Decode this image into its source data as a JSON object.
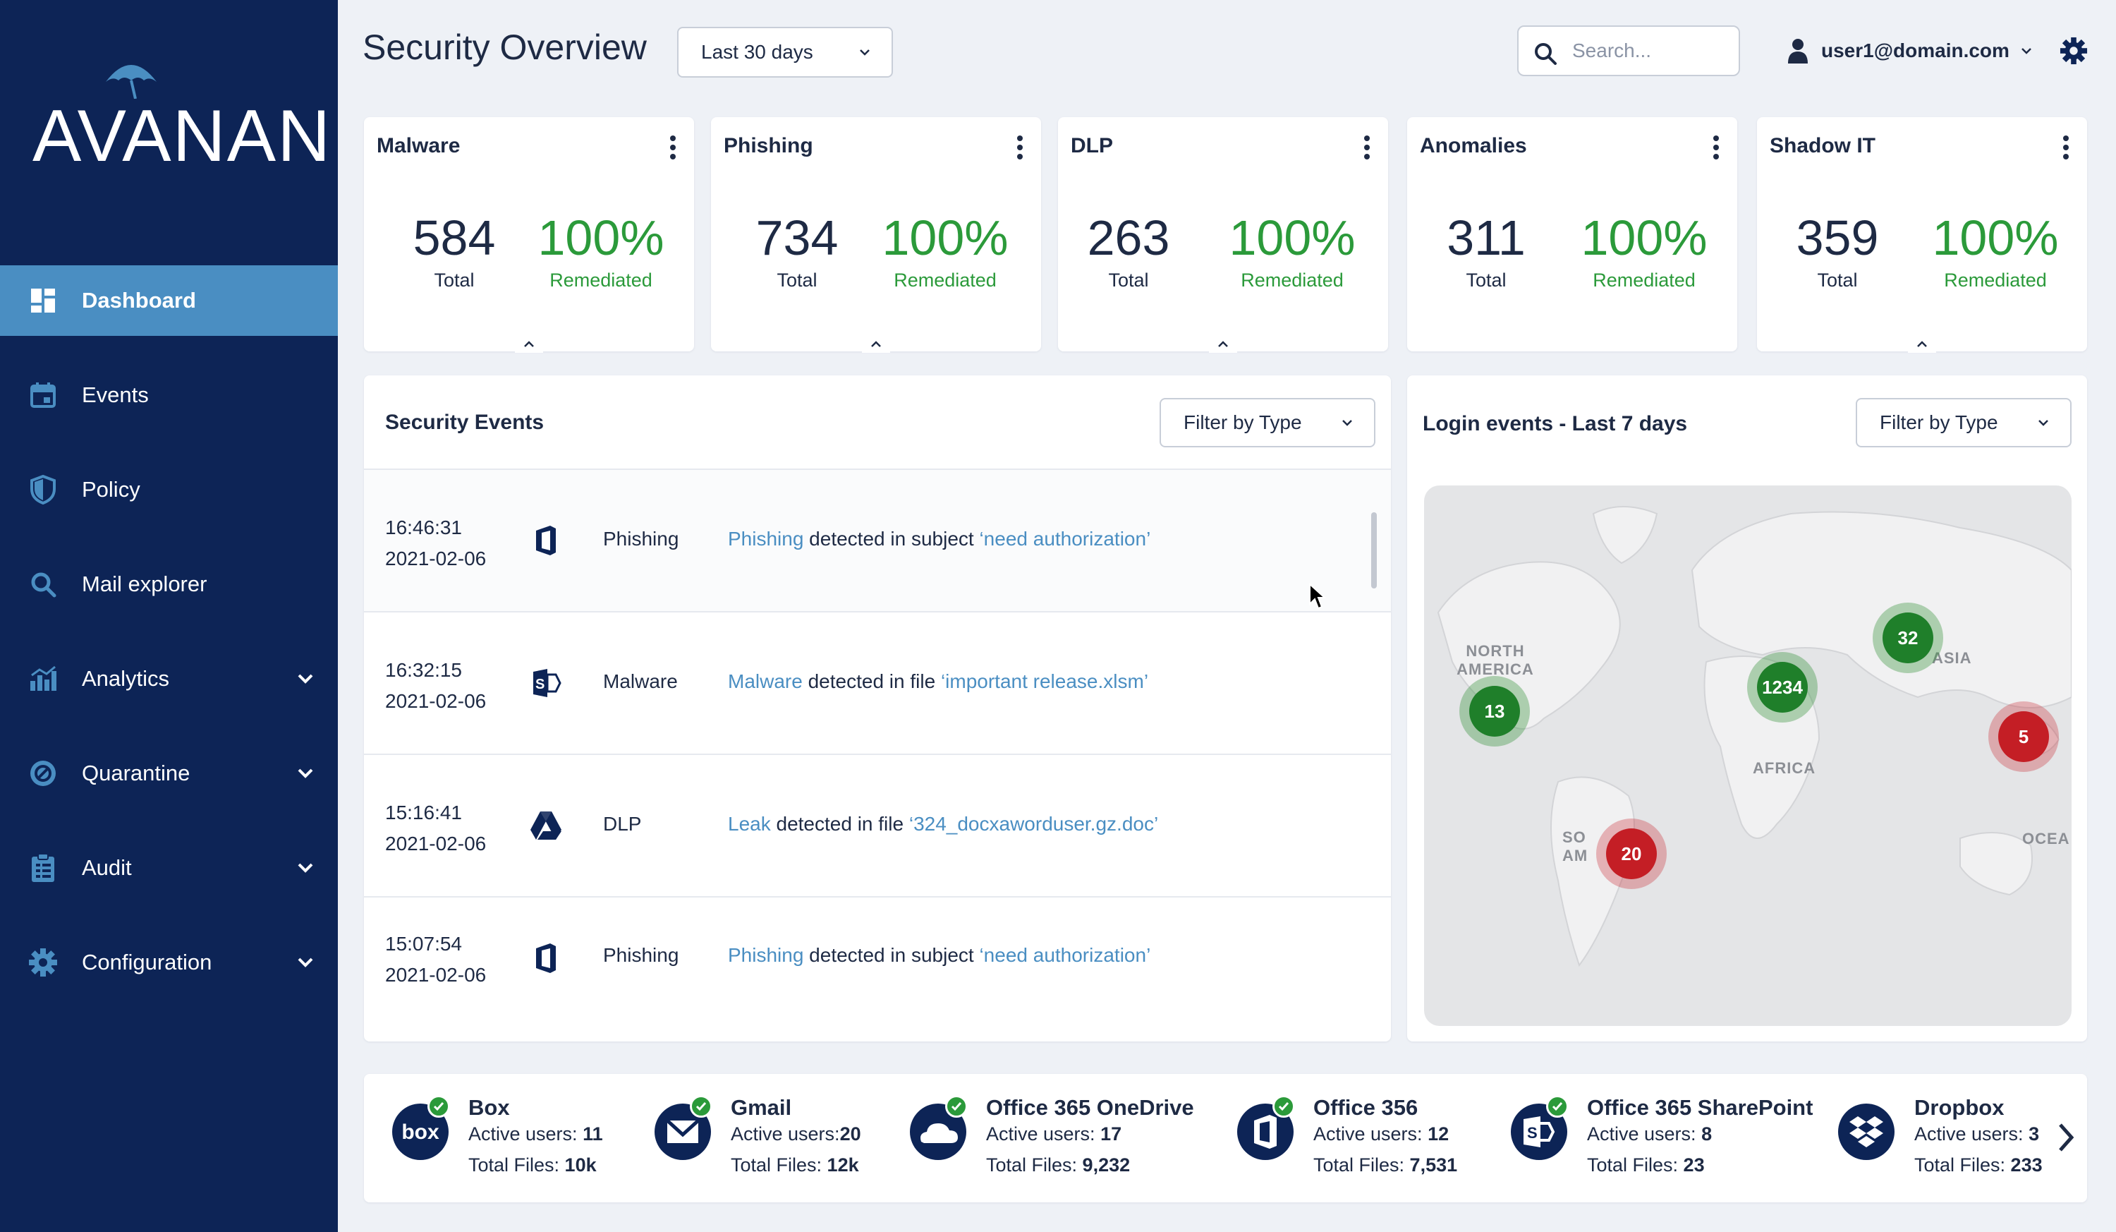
{
  "brand": {
    "logo_text": "AVANAN"
  },
  "nav": {
    "items": [
      {
        "label": "Dashboard",
        "icon": "dashboard-icon",
        "active": true
      },
      {
        "label": "Events",
        "icon": "calendar-icon"
      },
      {
        "label": "Policy",
        "icon": "shield-icon"
      },
      {
        "label": "Mail explorer",
        "icon": "search-icon"
      },
      {
        "label": "Analytics",
        "icon": "bar-chart-icon",
        "expandable": true
      },
      {
        "label": "Quarantine",
        "icon": "quarantine-icon",
        "expandable": true
      },
      {
        "label": "Audit",
        "icon": "clipboard-icon",
        "expandable": true
      },
      {
        "label": "Configuration",
        "icon": "gear-icon",
        "expandable": true
      }
    ]
  },
  "header": {
    "title": "Security Overview",
    "date_range": "Last 30 days",
    "search_placeholder": "Search...",
    "user": "user1@domain.com"
  },
  "stats": [
    {
      "title": "Malware",
      "total": "584",
      "total_label": "Total",
      "remediated": "100%",
      "remediated_label": "Remediated"
    },
    {
      "title": "Phishing",
      "total": "734",
      "total_label": "Total",
      "remediated": "100%",
      "remediated_label": "Remediated"
    },
    {
      "title": "DLP",
      "total": "263",
      "total_label": "Total",
      "remediated": "100%",
      "remediated_label": "Remediated"
    },
    {
      "title": "Anomalies",
      "total": "311",
      "total_label": "Total",
      "remediated": "100%",
      "remediated_label": "Remediated"
    },
    {
      "title": "Shadow IT",
      "total": "359",
      "total_label": "Total",
      "remediated": "100%",
      "remediated_label": "Remediated"
    }
  ],
  "security_events": {
    "title": "Security Events",
    "filter": "Filter by Type",
    "rows": [
      {
        "time": "16:46:31",
        "date": "2021-02-06",
        "icon": "office-icon",
        "type": "Phishing",
        "link": "Phishing",
        "middle": " detected in subject ",
        "target": "‘need authorization’"
      },
      {
        "time": "16:32:15",
        "date": "2021-02-06",
        "icon": "sharepoint-icon",
        "type": "Malware",
        "link": "Malware",
        "middle": " detected in file ",
        "target": "‘important release.xlsm’"
      },
      {
        "time": "15:16:41",
        "date": "2021-02-06",
        "icon": "google-drive-icon",
        "type": "DLP",
        "link": "Leak",
        "middle": " detected in file ",
        "target": "‘324_docxaworduser.gz.doc’"
      },
      {
        "time": "15:07:54",
        "date": "2021-02-06",
        "icon": "office-icon",
        "type": "Phishing",
        "link": "Phishing",
        "middle": " detected in subject ",
        "target": "‘need authorization’"
      }
    ]
  },
  "login_map": {
    "title": "Login events - Last 7 days",
    "filter": "Filter by Type",
    "labels": [
      "NORTH AMERICA",
      "ASIA",
      "AFRICA",
      "SO AM",
      "OCEA"
    ],
    "clusters": [
      {
        "value": "13",
        "status": "green"
      },
      {
        "value": "1234",
        "status": "green"
      },
      {
        "value": "32",
        "status": "green"
      },
      {
        "value": "5",
        "status": "red"
      },
      {
        "value": "20",
        "status": "red"
      }
    ]
  },
  "apps": [
    {
      "name": "Box",
      "users_label": "Active users: ",
      "users": "11",
      "files_label": "Total Files: ",
      "files": "10k",
      "icon": "box-icon"
    },
    {
      "name": "Gmail",
      "users_label": "Active users:",
      "users": "20",
      "files_label": "Total Files: ",
      "files": "12k",
      "icon": "gmail-icon"
    },
    {
      "name": "Office 365 OneDrive",
      "users_label": "Active users: ",
      "users": "17",
      "files_label": "Total Files: ",
      "files": "9,232",
      "icon": "onedrive-icon"
    },
    {
      "name": "Office 356",
      "users_label": "Active users: ",
      "users": "12",
      "files_label": "Total Files: ",
      "files": "7,531",
      "icon": "office-icon"
    },
    {
      "name": "Office 365 SharePoint",
      "users_label": "Active users: ",
      "users": "8",
      "files_label": "Total Files: ",
      "files": "23",
      "icon": "sharepoint-icon"
    },
    {
      "name": "Dropbox",
      "users_label": "Active users: ",
      "users": "3",
      "files_label": "Total Files: ",
      "files": "233",
      "icon": "dropbox-icon"
    }
  ],
  "colors": {
    "sidebar": "#0d2456",
    "active": "#4a8ec2",
    "green": "#2b9a3a",
    "red": "#c41e25",
    "link": "#4a8ec2"
  }
}
